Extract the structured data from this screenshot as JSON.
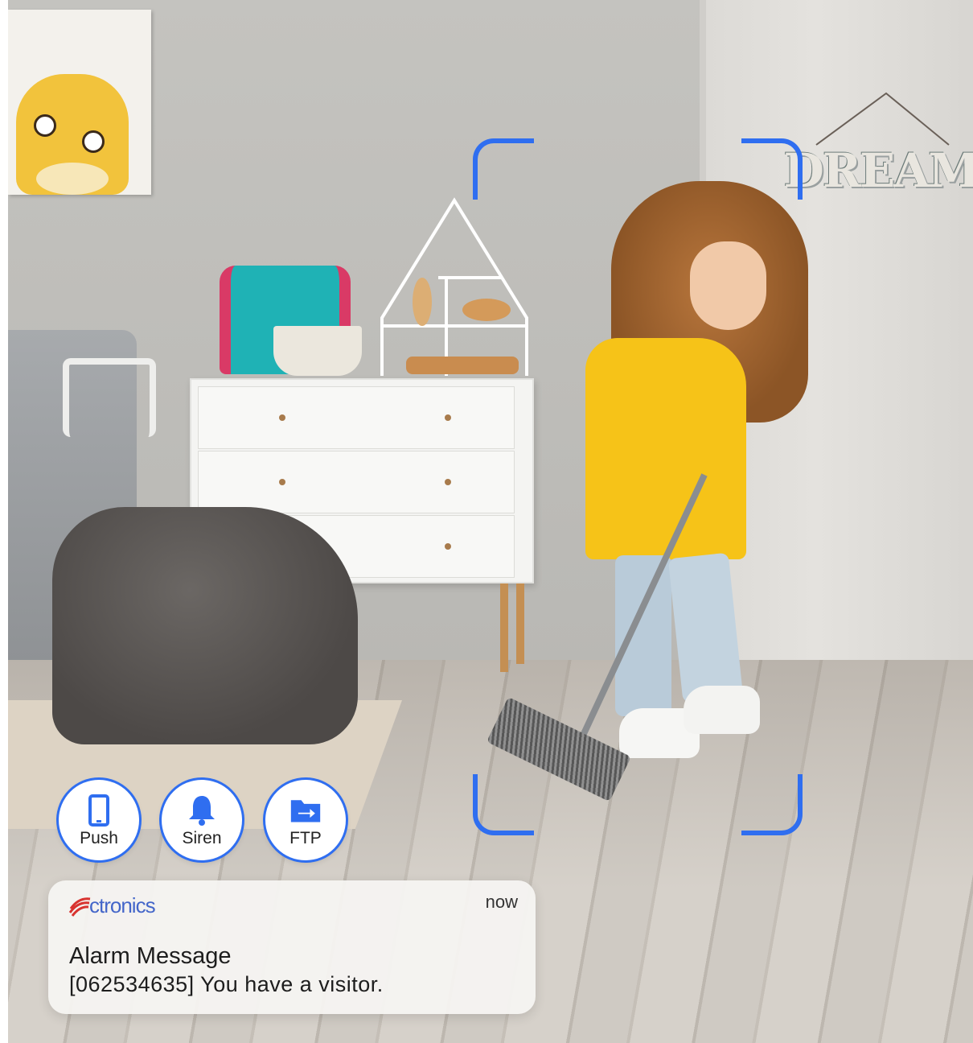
{
  "camera_view": {
    "wall_sign_text": "DREAM",
    "detection_frame_color": "#2f6ef0"
  },
  "actions": [
    {
      "label": "Push",
      "icon": "phone-icon"
    },
    {
      "label": "Siren",
      "icon": "bell-icon"
    },
    {
      "label": "FTP",
      "icon": "folder-upload-icon"
    }
  ],
  "notification": {
    "brand": "ctronics",
    "time": "now",
    "title": "Alarm Message",
    "message": "[062534635] You have a visitor."
  },
  "colors": {
    "accent": "#2f6ef0",
    "brand": "#4466c9",
    "brand_mark": "#d8332f"
  }
}
